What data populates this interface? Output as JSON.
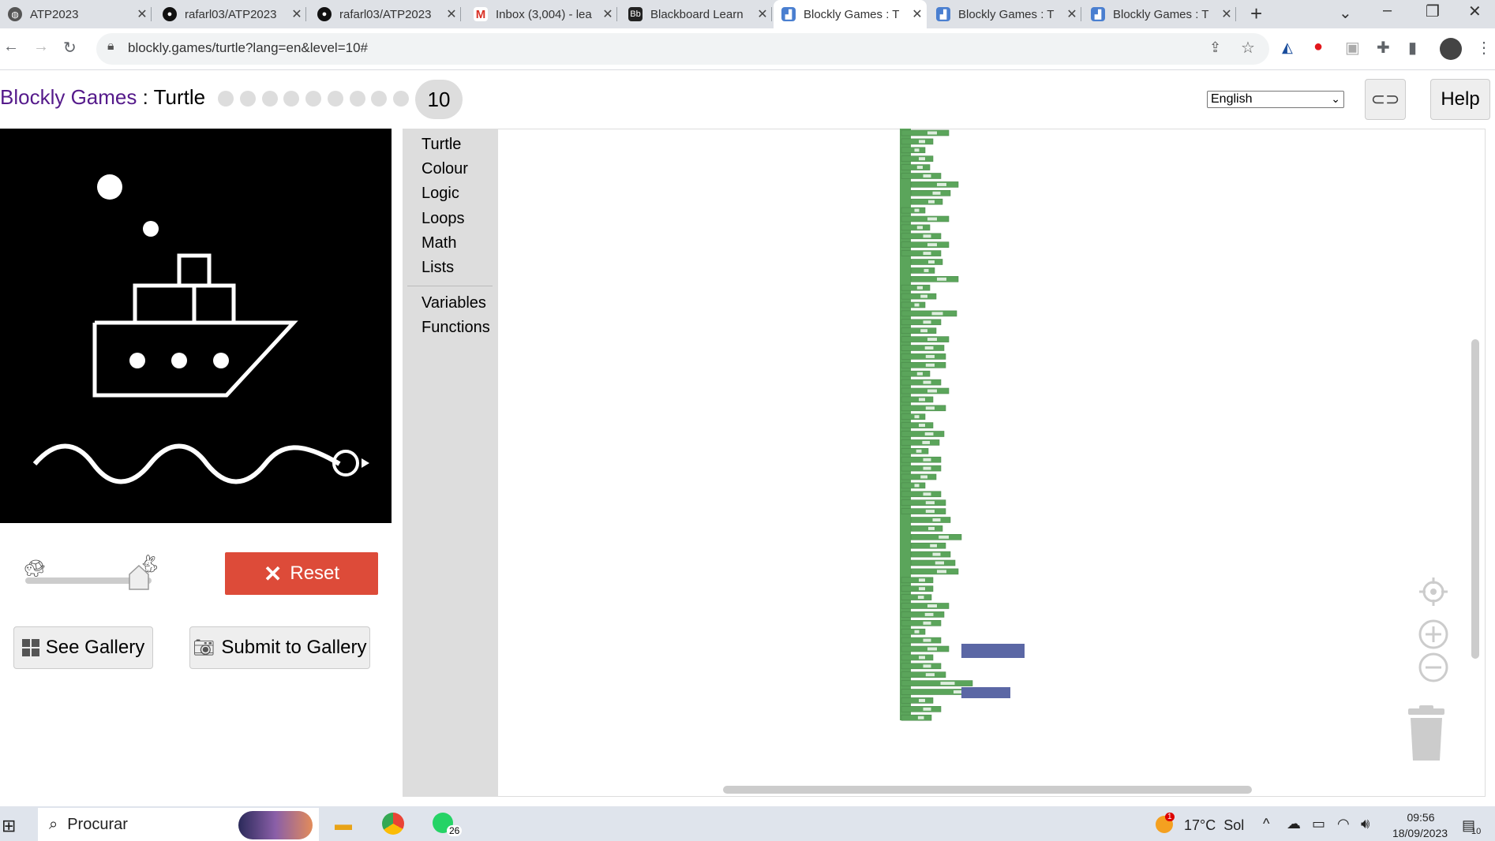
{
  "browser": {
    "tabs": [
      {
        "title": "ATP2023",
        "icon": "globe-icon"
      },
      {
        "title": "rafarl03/ATP2023",
        "icon": "github-icon"
      },
      {
        "title": "rafarl03/ATP2023",
        "icon": "github-icon"
      },
      {
        "title": "Inbox (3,004) - lea",
        "icon": "gmail-icon"
      },
      {
        "title": "Blackboard Learn",
        "icon": "blackboard-icon"
      },
      {
        "title": "Blockly Games : T",
        "icon": "blockly-icon"
      },
      {
        "title": "Blockly Games : T",
        "icon": "blockly-icon"
      },
      {
        "title": "Blockly Games : T",
        "icon": "blockly-icon"
      }
    ],
    "url": "blockly.games/turtle?lang=en&level=10#"
  },
  "header": {
    "brand": "Blockly Games",
    "separator": " : ",
    "game": "Turtle",
    "level": "10",
    "language": "English",
    "help_label": "Help"
  },
  "controls": {
    "reset_label": "Reset",
    "see_gallery_label": "See Gallery",
    "submit_gallery_label": "Submit to Gallery",
    "speed_level": 0.9
  },
  "toolbox": {
    "categories": [
      "Turtle",
      "Colour",
      "Logic",
      "Loops",
      "Math",
      "Lists"
    ],
    "categories2": [
      "Variables",
      "Functions"
    ]
  },
  "taskbar": {
    "search_placeholder": "Procurar",
    "whatsapp_badge": "26",
    "weather_badge": "1",
    "weather": "17°C  Sol",
    "time": "09:56",
    "date": "18/09/2023",
    "notification_count": "10"
  },
  "colors": {
    "accent_link": "#551a8b",
    "reset_bg": "#dd4b39",
    "block_green": "#5ba55b",
    "block_math": "#5b67a5"
  }
}
